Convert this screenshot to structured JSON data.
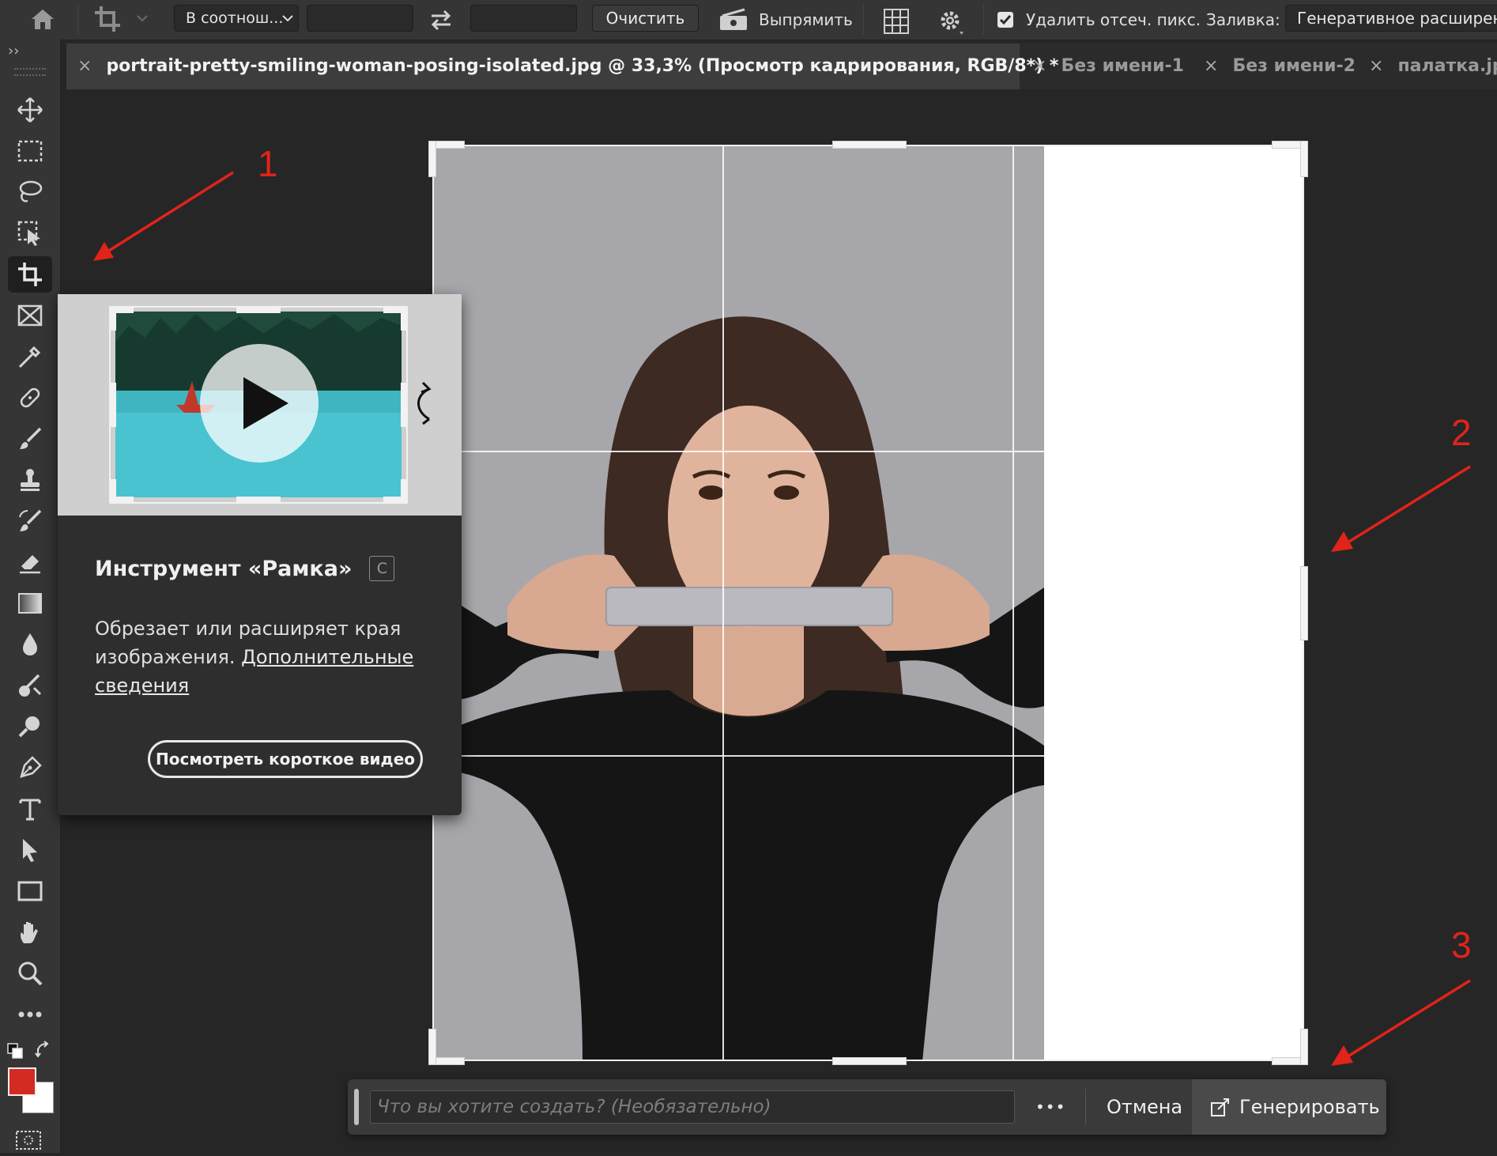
{
  "options_bar": {
    "ratio_select": "В соотнош...",
    "width_value": "",
    "height_value": "",
    "clear_label": "Очистить",
    "straighten_label": "Выпрямить",
    "delete_cropped_label": "Удалить отсеч. пикс.",
    "delete_cropped_checked": true,
    "fill_label": "Заливка:",
    "fill_value": "Генеративное расширени"
  },
  "tabs": [
    {
      "label": "portrait-pretty-smiling-woman-posing-isolated.jpg @ 33,3% (Просмотр кадрирования, RGB/8*) *",
      "active": true
    },
    {
      "label": "Без имени-1",
      "active": false
    },
    {
      "label": "Без имени-2",
      "active": false
    },
    {
      "label": "палатка.jpg",
      "active": false
    }
  ],
  "tooltip": {
    "title": "Инструмент «Рамка»",
    "shortcut": "C",
    "description": "Обрезает или расширяет края изображения.",
    "link_text": "Дополнительные сведения",
    "video_button": "Посмотреть короткое видео"
  },
  "generate_bar": {
    "prompt_placeholder": "Что вы хотите создать? (Необязательно)",
    "more_label": "•••",
    "cancel_label": "Отмена",
    "generate_label": "Генерировать"
  },
  "annotations": [
    "1",
    "2",
    "3"
  ],
  "colors": {
    "foreground": "#d42a22",
    "background": "#ffffff",
    "annotation": "#e2231a",
    "photo_background": "#a7a6ab",
    "extension_area": "#ffffff"
  }
}
